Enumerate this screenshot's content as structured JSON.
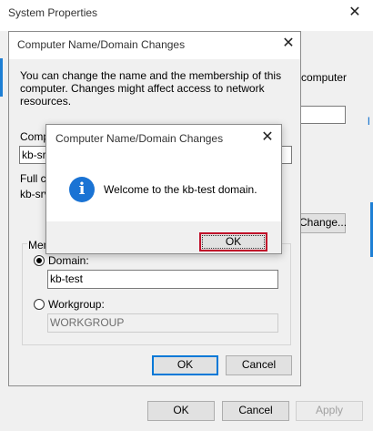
{
  "system_properties": {
    "title": "System Properties",
    "right_text_1": "computer",
    "change_button_label": "Change...",
    "ok_label": "OK",
    "cancel_label": "Cancel",
    "apply_label": "Apply"
  },
  "domain_changes": {
    "title": "Computer Name/Domain Changes",
    "description": "You can change the name and the membership of this computer. Changes might affect access to network resources.",
    "computer_name_label_partial": "Compu",
    "computer_name_value_partial": "kb-srv",
    "full_computer_name_partial": "Full co",
    "full_name_value_partial": "kb-srv-",
    "member_of_partial": "Mem",
    "domain_label": "Domain:",
    "domain_value": "kb-test",
    "workgroup_label": "Workgroup:",
    "workgroup_value": "WORKGROUP",
    "ok_label": "OK",
    "cancel_label": "Cancel"
  },
  "message_box": {
    "title": "Computer Name/Domain Changes",
    "message": "Welcome to the kb-test domain.",
    "icon": "info-icon",
    "ok_label": "OK"
  },
  "colors": {
    "accent": "#0078d7",
    "focus_outline": "#c0102a",
    "info_icon": "#1a73d4"
  }
}
